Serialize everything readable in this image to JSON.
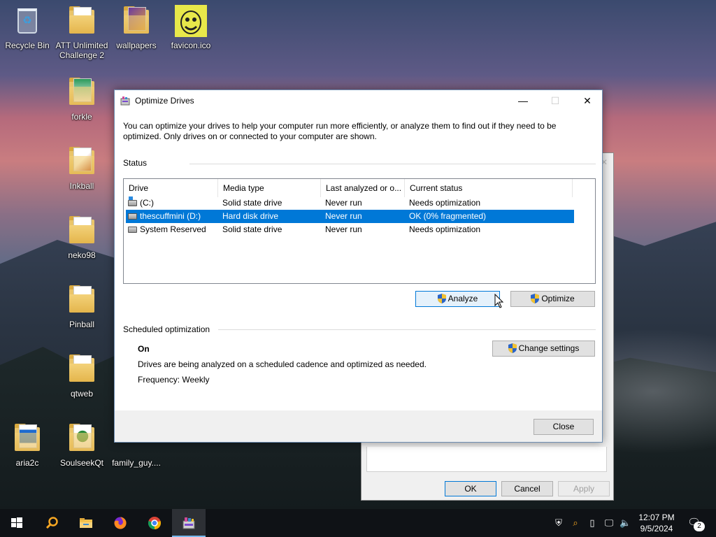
{
  "desktop": {
    "icons": [
      {
        "label": "Recycle Bin"
      },
      {
        "label": "ATT Unlimited Challenge 2"
      },
      {
        "label": "wallpapers"
      },
      {
        "label": "favicon.ico"
      },
      {
        "label": "forkle"
      },
      {
        "label": "Inkball"
      },
      {
        "label": "neko98"
      },
      {
        "label": "Pinball"
      },
      {
        "label": "qtweb"
      },
      {
        "label": "aria2c"
      },
      {
        "label": "SoulseekQt"
      },
      {
        "label": "family_guy...."
      }
    ]
  },
  "background_dialog": {
    "ok_label": "OK",
    "cancel_label": "Cancel",
    "apply_label": "Apply"
  },
  "dialog": {
    "title": "Optimize Drives",
    "description": "You can optimize your drives to help your computer run more efficiently, or analyze them to find out if they need to be optimized. Only drives on or connected to your computer are shown.",
    "status_label": "Status",
    "columns": [
      "Drive",
      "Media type",
      "Last analyzed or o...",
      "Current status"
    ],
    "drives": [
      {
        "drive": "(C:)",
        "media": "Solid state drive",
        "last": "Never run",
        "status": "Needs optimization"
      },
      {
        "drive": "thescuffmini (D:)",
        "media": "Hard disk drive",
        "last": "Never run",
        "status": "OK (0% fragmented)"
      },
      {
        "drive": "System Reserved",
        "media": "Solid state drive",
        "last": "Never run",
        "status": "Needs optimization"
      }
    ],
    "selected_row": 1,
    "analyze_label": "Analyze",
    "optimize_label": "Optimize",
    "scheduled_label": "Scheduled optimization",
    "schedule_state": "On",
    "schedule_desc": "Drives are being analyzed on a scheduled cadence and optimized as needed.",
    "frequency": "Frequency: Weekly",
    "change_settings_label": "Change settings",
    "close_label": "Close"
  },
  "taskbar": {
    "time": "12:07 PM",
    "date": "9/5/2024",
    "notification_count": "2"
  }
}
